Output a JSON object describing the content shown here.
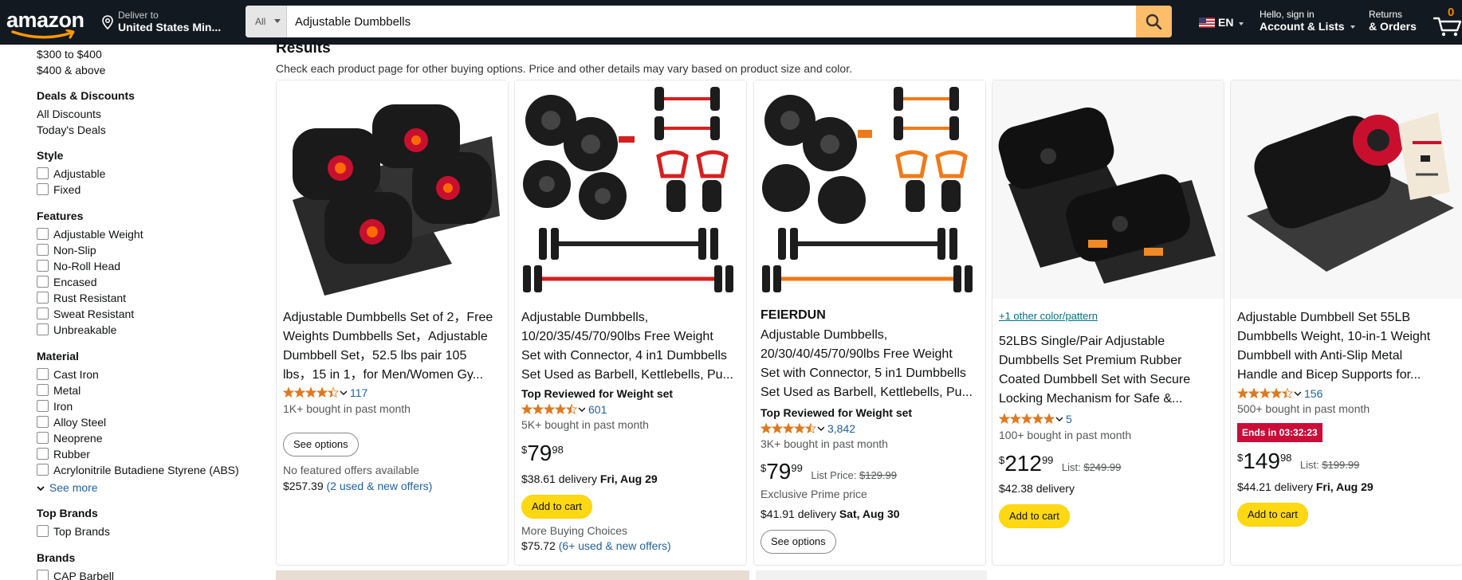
{
  "header": {
    "logo": "amazon",
    "deliver_line1": "Deliver to",
    "deliver_line2": "United States Min...",
    "search_category": "All",
    "search_value": "Adjustable Dumbbells",
    "lang": "EN",
    "account_line1": "Hello, sign in",
    "account_line2": "Account & Lists",
    "orders_line1": "Returns",
    "orders_line2": "& Orders",
    "cart_count": "0",
    "accent": "#febd69",
    "bar_color": "#131921"
  },
  "sidebar": {
    "price_items": [
      "$300 to $400",
      "$400 & above"
    ],
    "deals_title": "Deals & Discounts",
    "deals_items": [
      "All Discounts",
      "Today's Deals"
    ],
    "style_title": "Style",
    "style_items": [
      "Adjustable",
      "Fixed"
    ],
    "features_title": "Features",
    "features_items": [
      "Adjustable Weight",
      "Non-Slip",
      "No-Roll Head",
      "Encased",
      "Rust Resistant",
      "Sweat Resistant",
      "Unbreakable"
    ],
    "material_title": "Material",
    "material_items": [
      "Cast Iron",
      "Metal",
      "Iron",
      "Alloy Steel",
      "Neoprene",
      "Rubber",
      "Acrylonitrile Butadiene Styrene (ABS)"
    ],
    "see_more": "See more",
    "topbrands_title": "Top Brands",
    "topbrands_items": [
      "Top Brands"
    ],
    "brands_title": "Brands",
    "brands_items": [
      "CAP Barbell"
    ]
  },
  "results": {
    "title": "Results",
    "subtitle": "Check each product page for other buying options. Price and other details may vary based on product size and color."
  },
  "products": [
    {
      "title_lines": [
        "Adjustable Dumbbells Set of 2，Free",
        "Weights Dumbbells Set，Adjustable",
        "Dumbbell Set，52.5 lbs pair 105",
        "lbs，15 in 1，for Men/Women Gy..."
      ],
      "rating": 4.4,
      "reviews": "117",
      "bought": "1K+ bought in past month",
      "button": "See options",
      "no_offer": "No featured offers available",
      "alt_price": "$257.39",
      "alt_offers": "(2 used & new offers)"
    },
    {
      "title_lines": [
        "Adjustable Dumbbells,",
        "10/20/35/45/70/90lbs Free Weight",
        "Set with Connector, 4 in1 Dumbbells",
        "Set Used as Barbell, Kettlebells, Pu..."
      ],
      "top_reviewed": "Top Reviewed for Weight set",
      "rating": 4.5,
      "reviews": "601",
      "bought": "5K+ bought in past month",
      "price_sym": "$",
      "price_whole": "79",
      "price_frac": "98",
      "delivery_price": "$38.61 delivery",
      "delivery_date": "Fri, Aug 29",
      "button": "Add to cart",
      "more_choices": "More Buying Choices",
      "alt_price": "$75.72",
      "alt_offers": "(6+ used & new offers)"
    },
    {
      "brand": "FEIERDUN",
      "title_lines": [
        "Adjustable Dumbbells,",
        "20/30/40/45/70/90lbs Free Weight",
        "Set with Connector, 5 in1 Dumbbells",
        "Set Used as Barbell, Kettlebells, Pu..."
      ],
      "top_reviewed": "Top Reviewed for Weight set",
      "rating": 4.5,
      "reviews": "3,842",
      "bought": "3K+ bought in past month",
      "price_sym": "$",
      "price_whole": "79",
      "price_frac": "99",
      "list_label": "List Price:",
      "list_price": "$129.99",
      "prime_note": "Exclusive Prime price",
      "delivery_price": "$41.91 delivery",
      "delivery_date": "Sat, Aug 30",
      "button": "See options"
    },
    {
      "other_color": "+1 other color/pattern",
      "title_lines": [
        "52LBS Single/Pair Adjustable",
        "Dumbbells Set Premium Rubber",
        "Coated Dumbbell Set with Secure",
        "Locking Mechanism for Safe &..."
      ],
      "rating": 4.9,
      "reviews": "5",
      "bought": "100+ bought in past month",
      "price_sym": "$",
      "price_whole": "212",
      "price_frac": "99",
      "list_label": "List:",
      "list_price": "$249.99",
      "delivery_price": "$42.38 delivery",
      "button": "Add to cart"
    },
    {
      "title_lines": [
        "Adjustable Dumbbell Set 55LB",
        "Dumbbells Weight, 10-in-1 Weight",
        "Dumbbell with Anti-Slip Metal",
        "Handle and Bicep Supports for..."
      ],
      "rating": 4.4,
      "reviews": "156",
      "bought": "500+ bought in past month",
      "deal": "Ends in 03:32:23",
      "price_sym": "$",
      "price_whole": "149",
      "price_frac": "98",
      "list_label": "List:",
      "list_price": "$199.99",
      "delivery_price": "$44.21 delivery",
      "delivery_date": "Fri, Aug 29",
      "button": "Add to cart"
    }
  ]
}
